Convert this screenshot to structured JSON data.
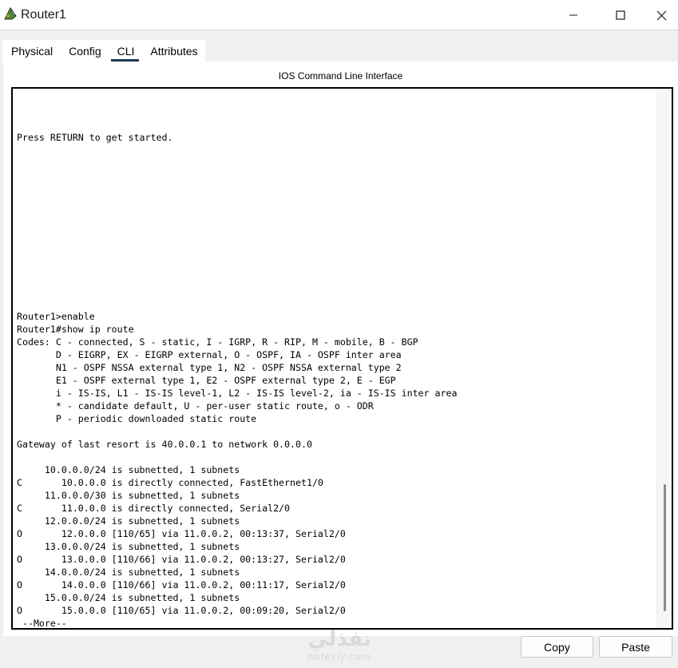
{
  "window": {
    "title": "Router1",
    "icon": "router-icon",
    "controls": [
      "minimize-icon",
      "maximize-icon",
      "close-icon"
    ]
  },
  "tabs": [
    {
      "label": "Physical",
      "active": false
    },
    {
      "label": "Config",
      "active": false
    },
    {
      "label": "CLI",
      "active": true
    },
    {
      "label": "Attributes",
      "active": false
    }
  ],
  "panel": {
    "title": "IOS Command Line Interface"
  },
  "terminal": {
    "lines": [
      "Press RETURN to get started.",
      "",
      "",
      "",
      "",
      "",
      "",
      "",
      "",
      "",
      "",
      "",
      "",
      "",
      "Router1>enable",
      "Router1#show ip route",
      "Codes: C - connected, S - static, I - IGRP, R - RIP, M - mobile, B - BGP",
      "       D - EIGRP, EX - EIGRP external, O - OSPF, IA - OSPF inter area",
      "       N1 - OSPF NSSA external type 1, N2 - OSPF NSSA external type 2",
      "       E1 - OSPF external type 1, E2 - OSPF external type 2, E - EGP",
      "       i - IS-IS, L1 - IS-IS level-1, L2 - IS-IS level-2, ia - IS-IS inter area",
      "       * - candidate default, U - per-user static route, o - ODR",
      "       P - periodic downloaded static route",
      "",
      "Gateway of last resort is 40.0.0.1 to network 0.0.0.0",
      "",
      "     10.0.0.0/24 is subnetted, 1 subnets",
      "C       10.0.0.0 is directly connected, FastEthernet1/0",
      "     11.0.0.0/30 is subnetted, 1 subnets",
      "C       11.0.0.0 is directly connected, Serial2/0",
      "     12.0.0.0/24 is subnetted, 1 subnets",
      "O       12.0.0.0 [110/65] via 11.0.0.2, 00:13:37, Serial2/0",
      "     13.0.0.0/24 is subnetted, 1 subnets",
      "O       13.0.0.0 [110/66] via 11.0.0.2, 00:13:27, Serial2/0",
      "     14.0.0.0/24 is subnetted, 1 subnets",
      "O       14.0.0.0 [110/66] via 11.0.0.2, 00:11:17, Serial2/0",
      "     15.0.0.0/24 is subnetted, 1 subnets",
      "O       15.0.0.0 [110/65] via 11.0.0.2, 00:09:20, Serial2/0",
      " --More--"
    ]
  },
  "buttons": {
    "copy": "Copy",
    "paste": "Paste"
  },
  "watermark": {
    "main": "نفذلي",
    "sub": "nafezly.com"
  },
  "colors": {
    "tab_underline": "#1b3a57",
    "terminal_border": "#000000",
    "background": "#f0f0f0"
  }
}
